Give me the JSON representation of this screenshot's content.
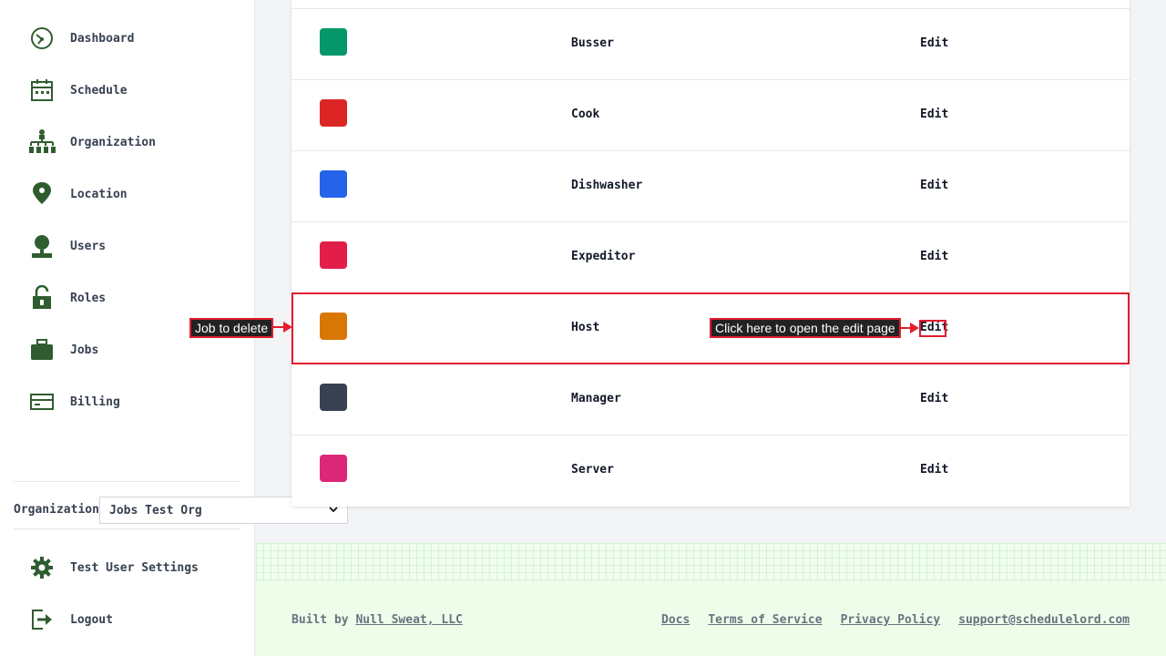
{
  "sidebar": {
    "nav": [
      {
        "id": "dashboard",
        "label": "Dashboard",
        "icon": "dashboard-gauge-icon"
      },
      {
        "id": "schedule",
        "label": "Schedule",
        "icon": "calendar-icon"
      },
      {
        "id": "organization",
        "label": "Organization",
        "icon": "org-chart-icon"
      },
      {
        "id": "location",
        "label": "Location",
        "icon": "map-pin-icon"
      },
      {
        "id": "users",
        "label": "Users",
        "icon": "user-icon"
      },
      {
        "id": "roles",
        "label": "Roles",
        "icon": "lock-icon"
      },
      {
        "id": "jobs",
        "label": "Jobs",
        "icon": "briefcase-icon"
      },
      {
        "id": "billing",
        "label": "Billing",
        "icon": "credit-card-icon"
      }
    ],
    "organization_label": "Organization",
    "organization_value": "Jobs Test Org",
    "bottom": [
      {
        "id": "settings",
        "label": "Test User Settings",
        "icon": "gear-icon"
      },
      {
        "id": "logout",
        "label": "Logout",
        "icon": "logout-icon"
      }
    ]
  },
  "jobs": [
    {
      "name": "Busser",
      "color": "#059669",
      "action": "Edit"
    },
    {
      "name": "Cook",
      "color": "#dc2626",
      "action": "Edit"
    },
    {
      "name": "Dishwasher",
      "color": "#2563eb",
      "action": "Edit"
    },
    {
      "name": "Expeditor",
      "color": "#e11d48",
      "action": "Edit"
    },
    {
      "name": "Host",
      "color": "#d97706",
      "action": "Edit"
    },
    {
      "name": "Manager",
      "color": "#374151",
      "action": "Edit"
    },
    {
      "name": "Server",
      "color": "#db2777",
      "action": "Edit"
    }
  ],
  "annotations": {
    "row_callout": "Job to delete",
    "edit_callout": "Click here to open the edit page"
  },
  "footer": {
    "built_by_prefix": "Built by",
    "built_by_link": "Null Sweat, LLC",
    "links": [
      "Docs",
      "Terms of Service",
      "Privacy Policy",
      "support@schedulelord.com"
    ]
  },
  "colors": {
    "icon_green": "#2f5d2f",
    "annotation_red": "#e11d2e",
    "footer_bg": "#edfdea"
  }
}
